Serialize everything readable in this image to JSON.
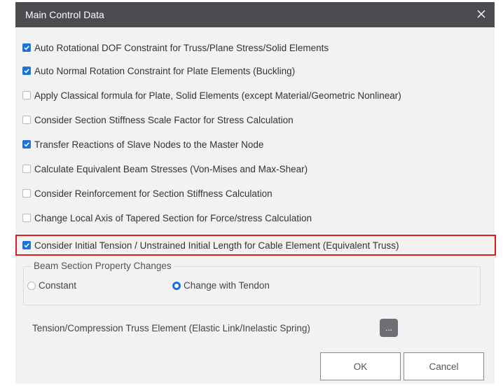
{
  "dialog": {
    "title": "Main Control Data",
    "close_icon": "close-icon"
  },
  "options": [
    {
      "label": "Auto Rotational DOF Constraint for Truss/Plane Stress/Solid Elements",
      "checked": true
    },
    {
      "label": "Auto Normal Rotation Constraint for Plate Elements (Buckling)",
      "checked": true
    },
    {
      "label": "Apply Classical formula for Plate, Solid Elements (except Material/Geometric Nonlinear)",
      "checked": false
    },
    {
      "label": "Consider Section Stiffness Scale Factor for Stress Calculation",
      "checked": false
    },
    {
      "label": "Transfer Reactions of Slave Nodes to the Master Node",
      "checked": true
    },
    {
      "label": "Calculate Equivalent Beam Stresses (Von-Mises and Max-Shear)",
      "checked": false
    },
    {
      "label": "Consider Reinforcement for Section Stiffness Calculation",
      "checked": false
    },
    {
      "label": "Change Local Axis of Tapered Section for Force/stress Calculation",
      "checked": false
    },
    {
      "label": "Consider Initial Tension / Unstrained Initial Length for Cable Element (Equivalent Truss)",
      "checked": true
    }
  ],
  "beam_section": {
    "legend": "Beam Section Property Changes",
    "options": [
      {
        "label": "Constant",
        "selected": false
      },
      {
        "label": "Change with Tendon",
        "selected": true
      }
    ]
  },
  "tension": {
    "label": "Tension/Compression Truss Element (Elastic Link/Inelastic Spring)",
    "button_label": "..."
  },
  "buttons": {
    "ok": "OK",
    "cancel": "Cancel"
  },
  "colors": {
    "titlebar": "#4b4b50",
    "accent": "#1a73d6",
    "highlight": "#e01b1b"
  }
}
